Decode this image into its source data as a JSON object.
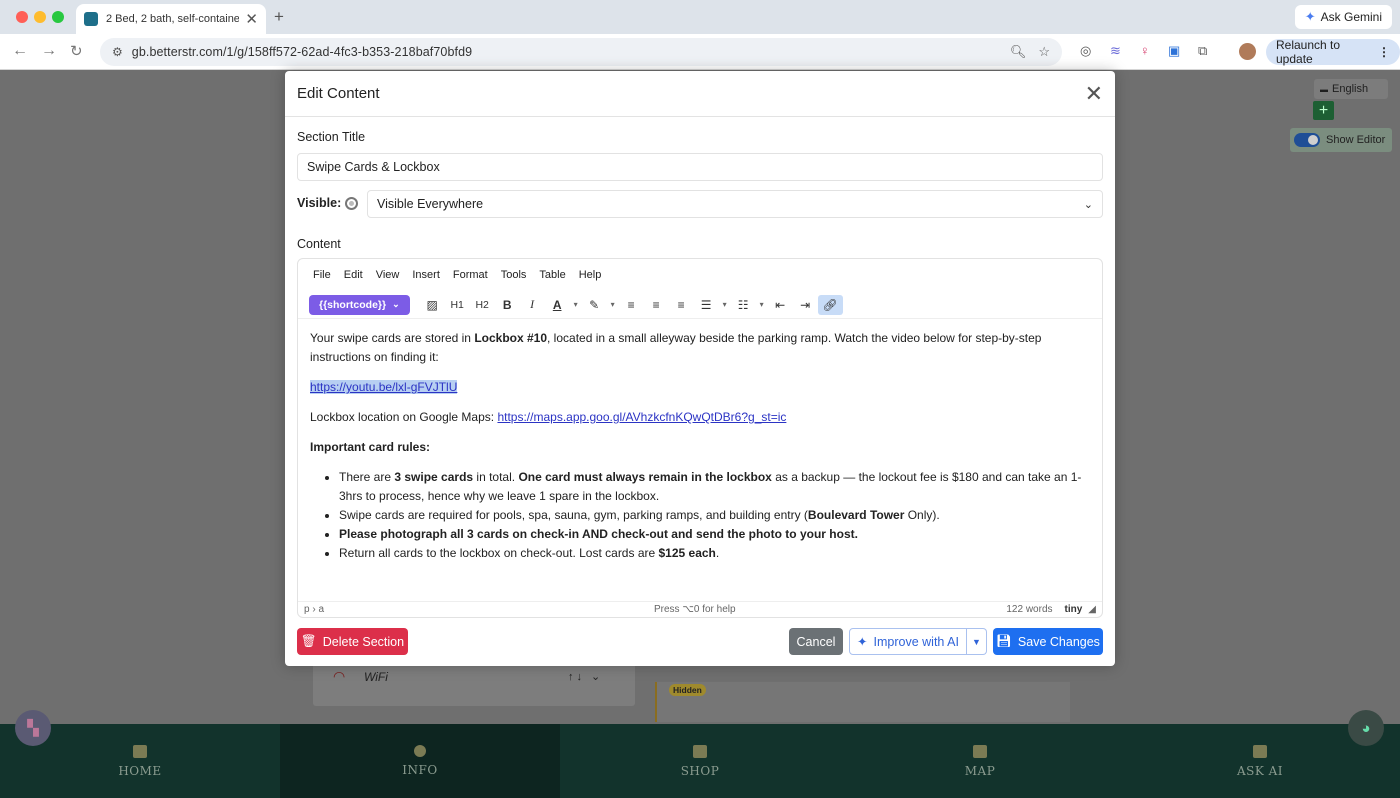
{
  "browser": {
    "tab_title": "2 Bed, 2 bath, self-contained",
    "tab_close": "✕",
    "new_tab": "+",
    "ask_gemini": "Ask Gemini",
    "url": "gb.betterstr.com/1/g/158ff572-62ad-4fc3-b353-218baf70bfd9",
    "relaunch": "Relaunch to update"
  },
  "page": {
    "language": "English",
    "show_editor": "Show Editor",
    "card_wifi": "WiFi",
    "hidden_badge": "Hidden",
    "nav": [
      {
        "label": "HOME",
        "icon": "home-icon"
      },
      {
        "label": "INFO",
        "icon": "info-icon"
      },
      {
        "label": "SHOP",
        "icon": "bag-icon"
      },
      {
        "label": "MAP",
        "icon": "map-icon"
      },
      {
        "label": "ASK AI",
        "icon": "robot-icon"
      }
    ],
    "active_nav": "INFO"
  },
  "modal": {
    "title": "Edit Content",
    "section_title_label": "Section Title",
    "section_title_value": "Swipe Cards & Lockbox",
    "visible_label": "Visible:",
    "visible_value": "Visible Everywhere",
    "content_label": "Content",
    "menu": [
      "File",
      "Edit",
      "View",
      "Insert",
      "Format",
      "Tools",
      "Table",
      "Help"
    ],
    "shortcode": "{{shortcode}}",
    "toolbar": {
      "h1": "H1",
      "h2": "H2",
      "bold": "B",
      "italic": "I",
      "text_color": "A"
    },
    "content": {
      "p1_a": "Your swipe cards are stored in ",
      "p1_b": "Lockbox #10",
      "p1_c": ", located in a small alleyway beside the parking ramp. Watch the video below for step-by-step instructions on finding it:",
      "video_link": "https://youtu.be/lxl-gFVJTlU",
      "maps_prefix": "Lockbox location on Google Maps: ",
      "maps_link": "https://maps.app.goo.gl/AVhzkcfnKQwQtDBr6?g_st=ic",
      "rules_heading": "Important card rules:",
      "li1_a": "There are ",
      "li1_b": "3 swipe cards",
      "li1_c": " in total. ",
      "li1_d": "One card must always remain in the lockbox",
      "li1_e": " as a backup — the lockout fee is $180 and can take an 1-3hrs to process, hence why we leave 1 spare in the lockbox.",
      "li2_a": "Swipe cards are required for pools, spa, sauna, gym, parking ramps, and building entry (",
      "li2_b": "Boulevard Tower",
      "li2_c": " Only).",
      "li3": "Please photograph all 3 cards on check-in AND check-out and send the photo to your host.",
      "li4_a": "Return all cards to the lockbox on check-out. Lost cards are ",
      "li4_b": "$125 each",
      "li4_c": "."
    },
    "status": {
      "path": "p › a",
      "help": "Press ⌥0 for help",
      "words": "122 words",
      "brand": "tiny"
    },
    "buttons": {
      "delete": "Delete Section",
      "cancel": "Cancel",
      "improve": "Improve with AI",
      "save": "Save Changes"
    }
  },
  "colors": {
    "shortcode_bg": "#7c5ce6",
    "delete_bg": "#dc2f4a",
    "save_bg": "#1e6ff0",
    "nav_bg": "#12332c",
    "link": "#2b33c4"
  }
}
